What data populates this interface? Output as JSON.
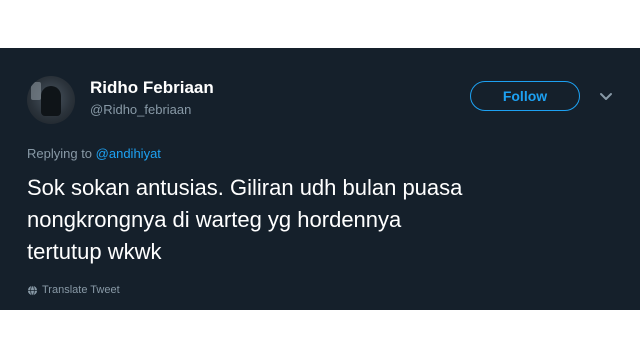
{
  "tweet": {
    "display_name": "Ridho Febriaan",
    "handle": "@Ridho_febriaan",
    "follow_label": "Follow",
    "replying_prefix": "Replying to",
    "replying_to": "@andihiyat",
    "text": "Sok sokan antusias. Giliran udh bulan puasa\nnongkrongnya di warteg yg hordennya\ntertutup wkwk",
    "translate_label": "Translate Tweet"
  },
  "icons": {
    "caret": "chevron-down-icon",
    "translate": "globe-icon"
  },
  "colors": {
    "background": "#15202b",
    "accent": "#1da1f2",
    "secondary_text": "#8899a6",
    "primary_text": "#ffffff"
  }
}
